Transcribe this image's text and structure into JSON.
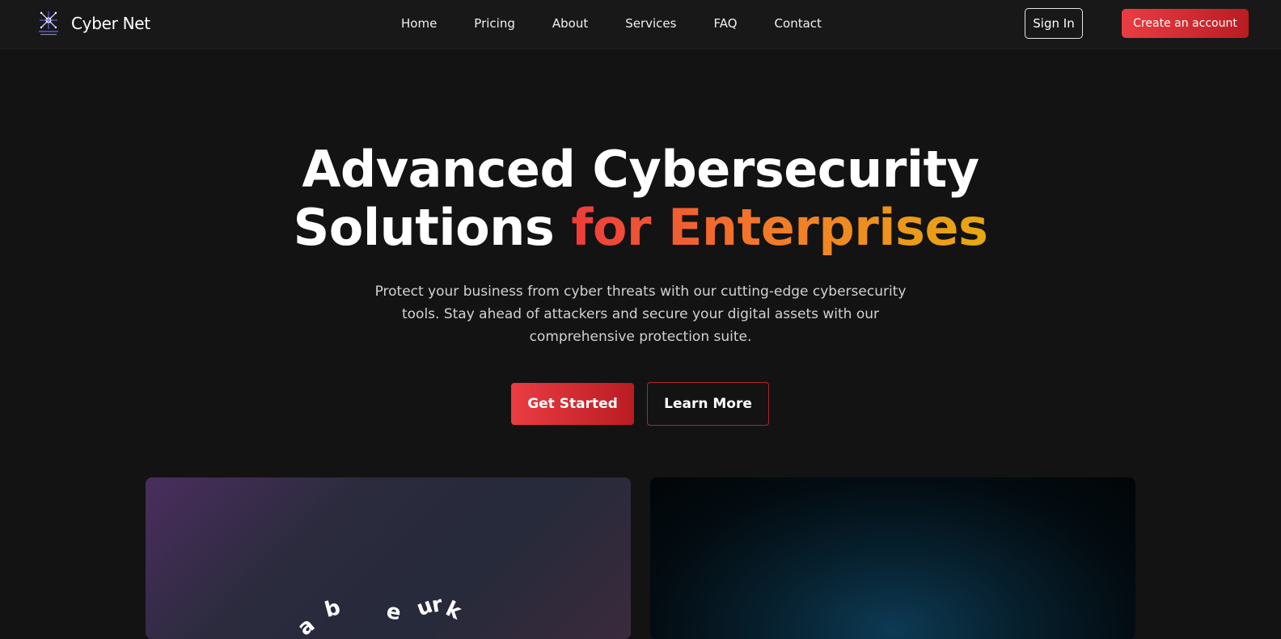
{
  "header": {
    "brand_name": "Cyber Net",
    "logo_icon": "cyber-net-logo-icon",
    "nav": [
      "Home",
      "Pricing",
      "About",
      "Services",
      "FAQ",
      "Contact"
    ],
    "sign_in_label": "Sign In",
    "create_account_label": "Create an account"
  },
  "hero": {
    "title_line1": "Advanced Cybersecurity",
    "title_line2_plain": "Solutions",
    "title_line2_accent": "for Enterprises",
    "description": "Protect your business from cyber threats with our cutting-edge cybersecurity tools. Stay ahead of attackers and secure your digital assets with our comprehensive protection suite.",
    "get_started_label": "Get Started",
    "learn_more_label": "Learn More"
  },
  "cards": {
    "left_letters": [
      "a",
      "b",
      "e",
      "u",
      "r",
      "k"
    ]
  },
  "colors": {
    "background": "#131313",
    "navbar": "#181818",
    "accent_red": "#ea3c43",
    "accent_orange": "#f2782a",
    "accent_yellow": "#e8a912"
  }
}
